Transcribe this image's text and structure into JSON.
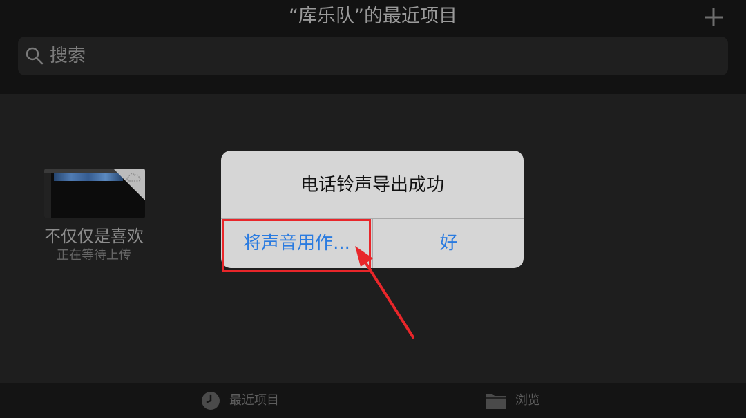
{
  "header": {
    "title": "“库乐队”的最近项目",
    "add_icon": "plus-icon"
  },
  "search": {
    "placeholder": "搜索",
    "icon": "magnifier-icon"
  },
  "projects": [
    {
      "name": "不仅仅是喜欢",
      "status": "正在等待上传"
    }
  ],
  "alert": {
    "title": "电话铃声导出成功",
    "buttons": {
      "use_as": "将声音用作...",
      "ok": "好"
    },
    "colors": {
      "button_text": "#2a7be0",
      "background": "#d6d6d6"
    }
  },
  "tabbar": {
    "recent_label": "最近项目",
    "browse_label": "浏览"
  },
  "annotation": {
    "highlight_color": "#e8262a"
  }
}
